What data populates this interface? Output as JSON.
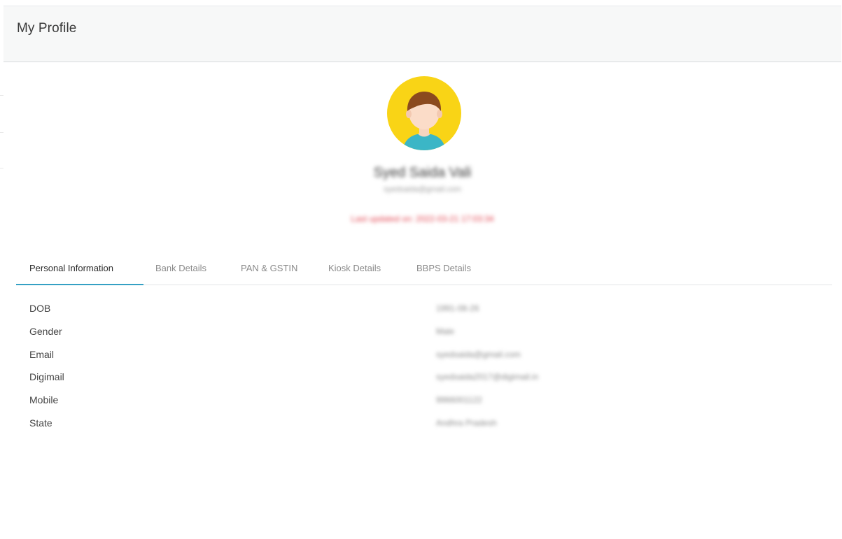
{
  "header": {
    "title": "My Profile"
  },
  "profile": {
    "name": "Syed Saida Vali",
    "email": "syedsaida@gmail.com",
    "last_updated": "Last updated on: 2022-03-21 17:03:34"
  },
  "tabs": [
    {
      "label": "Personal Information",
      "active": true
    },
    {
      "label": "Bank Details",
      "active": false
    },
    {
      "label": "PAN & GSTIN",
      "active": false
    },
    {
      "label": "Kiosk Details",
      "active": false
    },
    {
      "label": "BBPS Details",
      "active": false
    }
  ],
  "personal_info": [
    {
      "label": "DOB",
      "value": "1991-08-26"
    },
    {
      "label": "Gender",
      "value": "Male"
    },
    {
      "label": "Email",
      "value": "syedsaida@gmail.com"
    },
    {
      "label": "Digimail",
      "value": "syedsaida2017@digimail.in"
    },
    {
      "label": "Mobile",
      "value": "9966001122"
    },
    {
      "label": "State",
      "value": "Andhra Pradesh"
    }
  ],
  "colors": {
    "accent": "#35a0c4",
    "header_bg": "#f7f8f8",
    "last_updated": "#e2434f",
    "avatar_bg": "#f9d416"
  },
  "icons": {
    "avatar": "user-avatar-icon"
  }
}
